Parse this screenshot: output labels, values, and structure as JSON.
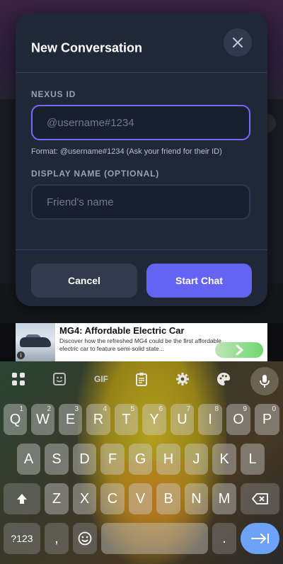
{
  "dialog": {
    "title": "New Conversation",
    "id_label": "NEXUS ID",
    "id_placeholder": "@username#1234",
    "id_hint": "Format: @username#1234 (Ask your friend for their ID)",
    "name_label": "DISPLAY NAME (OPTIONAL)",
    "name_placeholder": "Friend's name",
    "cancel_label": "Cancel",
    "start_label": "Start Chat",
    "accent_color": "#6464f2"
  },
  "ad": {
    "title": "MG4: Affordable Electric Car",
    "description": "Discover how the refreshed MG4 could be the first affordable electric car to feature semi-solid state...",
    "info_icon": "i"
  },
  "keyboard": {
    "toolbar_gif": "GIF",
    "row1": [
      {
        "key": "Q",
        "num": "1"
      },
      {
        "key": "W",
        "num": "2"
      },
      {
        "key": "E",
        "num": "3"
      },
      {
        "key": "R",
        "num": "4"
      },
      {
        "key": "T",
        "num": "5"
      },
      {
        "key": "Y",
        "num": "6"
      },
      {
        "key": "U",
        "num": "7"
      },
      {
        "key": "I",
        "num": "8"
      },
      {
        "key": "O",
        "num": "9"
      },
      {
        "key": "P",
        "num": "0"
      }
    ],
    "row2": [
      "A",
      "S",
      "D",
      "F",
      "G",
      "H",
      "J",
      "K",
      "L"
    ],
    "row3": [
      "Z",
      "X",
      "C",
      "V",
      "B",
      "N",
      "M"
    ],
    "symbols_label": "?123",
    "comma_label": ",",
    "period_label": "."
  }
}
